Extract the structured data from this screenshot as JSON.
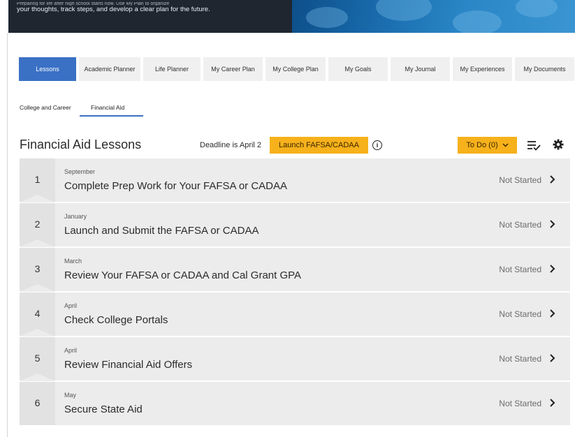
{
  "hero": {
    "line_faded": "Preparing for life after high school starts now. Use My Plan to organize",
    "line": "your thoughts, track steps, and develop a clear plan for the future."
  },
  "main_tabs": [
    {
      "label": "Lessons",
      "active": true
    },
    {
      "label": "Academic Planner"
    },
    {
      "label": "Life Planner"
    },
    {
      "label": "My Career Plan"
    },
    {
      "label": "My College Plan"
    },
    {
      "label": "My Goals"
    },
    {
      "label": "My Journal"
    },
    {
      "label": "My Experiences"
    },
    {
      "label": "My Documents"
    }
  ],
  "sub_tabs": [
    {
      "label": "College and Career"
    },
    {
      "label": "Financial Aid",
      "active": true
    }
  ],
  "header": {
    "title": "Financial Aid Lessons",
    "deadline": "Deadline is April 2",
    "launch_label": "Launch FAFSA/CADAA",
    "todo_label": "To Do (0)",
    "info_glyph": "i"
  },
  "lessons": [
    {
      "number": "1",
      "month": "September",
      "title": "Complete Prep Work for Your FAFSA or CADAA",
      "status": "Not Started"
    },
    {
      "number": "2",
      "month": "January",
      "title": "Launch and Submit the FAFSA or CADAA",
      "status": "Not Started"
    },
    {
      "number": "3",
      "month": "March",
      "title": "Review Your FAFSA or CADAA and Cal Grant GPA",
      "status": "Not Started"
    },
    {
      "number": "4",
      "month": "April",
      "title": "Check College Portals",
      "status": "Not Started"
    },
    {
      "number": "5",
      "month": "April",
      "title": "Review Financial Aid Offers",
      "status": "Not Started"
    },
    {
      "number": "6",
      "month": "May",
      "title": "Secure State Aid",
      "status": "Not Started"
    }
  ],
  "colors": {
    "accent": "#3a71c5",
    "button": "#f6b11b",
    "row_bg": "#ececec",
    "hero_dark": "#1f2630"
  },
  "icons": {
    "info": "info-circle-icon",
    "todo_caret": "chevron-down-icon",
    "sort": "sort-check-icon",
    "settings": "gear-icon",
    "row_arrow": "chevron-right-icon"
  }
}
